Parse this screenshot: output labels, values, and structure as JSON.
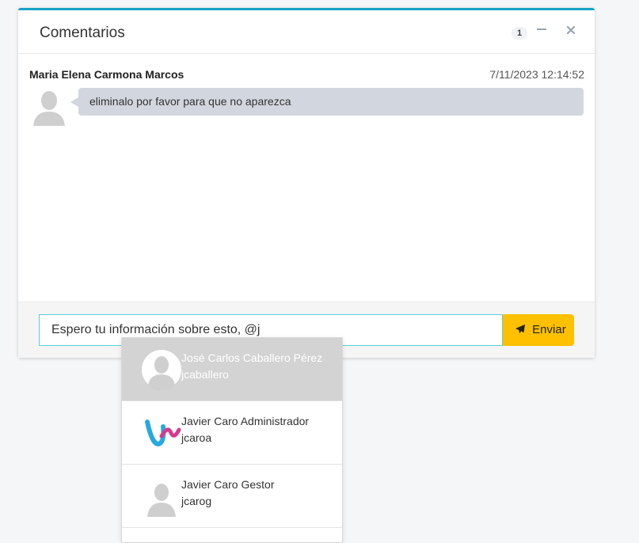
{
  "panel": {
    "title": "Comentarios",
    "badge_count": "1",
    "minimize_icon": "minus-icon",
    "close_icon": "close-icon",
    "accent_color": "#17a2c6"
  },
  "messages": [
    {
      "author": "Maria Elena Carmona Marcos",
      "timestamp": "7/11/2023 12:14:52",
      "text": "eliminalo por favor para que no aparezca",
      "avatar_icon": "user-placeholder-icon"
    }
  ],
  "composer": {
    "value": "Espero tu información sobre esto, @j",
    "send_label": "Enviar",
    "send_icon": "paper-plane-icon",
    "send_color": "#ffc000"
  },
  "mentions": [
    {
      "name": "José Carlos Caballero Pérez",
      "username": "jcaballero",
      "avatar": "user-placeholder-icon",
      "active": true
    },
    {
      "name": "Javier Caro Administrador",
      "username": "jcaroa",
      "avatar": "brand-logo-icon",
      "active": false
    },
    {
      "name": "Javier Caro Gestor",
      "username": "jcarog",
      "avatar": "user-placeholder-icon",
      "active": false
    }
  ]
}
